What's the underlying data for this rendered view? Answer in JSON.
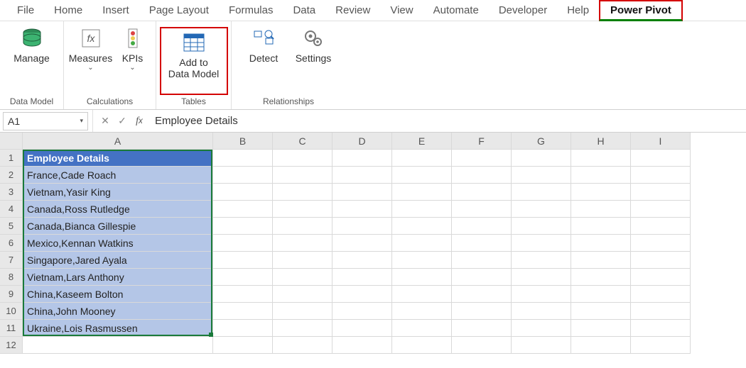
{
  "tabs": {
    "file": "File",
    "home": "Home",
    "insert": "Insert",
    "page_layout": "Page Layout",
    "formulas": "Formulas",
    "data": "Data",
    "review": "Review",
    "view": "View",
    "automate": "Automate",
    "developer": "Developer",
    "help": "Help",
    "power_pivot": "Power Pivot"
  },
  "ribbon": {
    "data_model_group": "Data Model",
    "manage": "Manage",
    "calculations_group": "Calculations",
    "measures": "Measures",
    "kpis": "KPIs",
    "tables_group": "Tables",
    "add_to_data_model_line1": "Add to",
    "add_to_data_model_line2": "Data Model",
    "relationships_group": "Relationships",
    "detect": "Detect",
    "settings": "Settings"
  },
  "formula_bar": {
    "cell_ref": "A1",
    "formula": "Employee Details"
  },
  "columns": [
    "A",
    "B",
    "C",
    "D",
    "E",
    "F",
    "G",
    "H",
    "I"
  ],
  "rows": [
    {
      "n": 1,
      "a": "Employee Details",
      "header": true
    },
    {
      "n": 2,
      "a": "France,Cade Roach"
    },
    {
      "n": 3,
      "a": "Vietnam,Yasir King"
    },
    {
      "n": 4,
      "a": "Canada,Ross Rutledge"
    },
    {
      "n": 5,
      "a": "Canada,Bianca Gillespie"
    },
    {
      "n": 6,
      "a": "Mexico,Kennan Watkins"
    },
    {
      "n": 7,
      "a": "Singapore,Jared Ayala"
    },
    {
      "n": 8,
      "a": "Vietnam,Lars Anthony"
    },
    {
      "n": 9,
      "a": "China,Kaseem Bolton"
    },
    {
      "n": 10,
      "a": "China,John Mooney"
    },
    {
      "n": 11,
      "a": "Ukraine,Lois Rasmussen"
    },
    {
      "n": 12,
      "a": ""
    }
  ]
}
